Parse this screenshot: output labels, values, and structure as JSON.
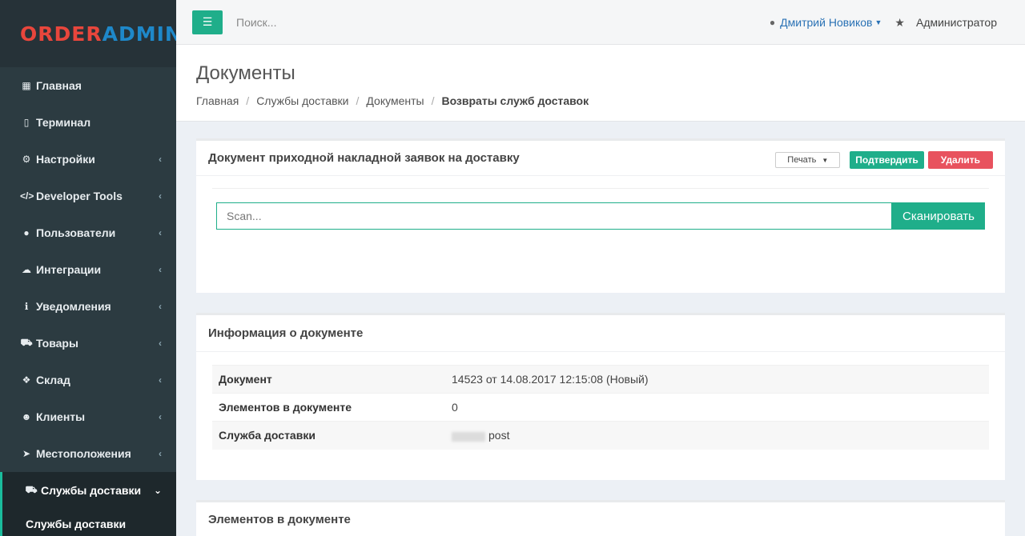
{
  "logo": {
    "part1": "ORDER",
    "part2": "ADMIN"
  },
  "sidebar": {
    "items": [
      {
        "label": "Главная",
        "icon": "grid-icon",
        "chevron": false
      },
      {
        "label": "Терминал",
        "icon": "tablet-icon",
        "chevron": false
      },
      {
        "label": "Настройки",
        "icon": "gear-icon",
        "chevron": true
      },
      {
        "label": "Developer Tools",
        "icon": "code-icon",
        "chevron": true
      },
      {
        "label": "Пользователи",
        "icon": "user-icon",
        "chevron": true
      },
      {
        "label": "Интеграции",
        "icon": "cloud-icon",
        "chevron": true
      },
      {
        "label": "Уведомления",
        "icon": "info-icon",
        "chevron": true
      },
      {
        "label": "Товары",
        "icon": "cart-icon",
        "chevron": true
      },
      {
        "label": "Склад",
        "icon": "cubes-icon",
        "chevron": true
      },
      {
        "label": "Клиенты",
        "icon": "users-icon",
        "chevron": true
      },
      {
        "label": "Местоположения",
        "icon": "location-arrow-icon",
        "chevron": true
      },
      {
        "label": "Службы доставки",
        "icon": "truck-icon",
        "chevron": true,
        "active": true
      }
    ],
    "subitem": "Службы доставки"
  },
  "topbar": {
    "search_placeholder": "Поиск...",
    "user_name": "Дмитрий Новиков",
    "role": "Администратор"
  },
  "header": {
    "title": "Документы",
    "breadcrumb": [
      "Главная",
      "Службы доставки",
      "Документы",
      "Возвраты служб доставок"
    ]
  },
  "doc_box": {
    "title": "Документ приходной накладной заявок на доставку",
    "print_label": "Печать",
    "confirm_label": "Подтвердить",
    "delete_label": "Удалить",
    "scan_placeholder": "Scan...",
    "scan_button": "Сканировать"
  },
  "info_box": {
    "title": "Информация о документе",
    "rows": [
      {
        "key": "Документ",
        "value": "14523 от 14.08.2017 12:15:08 (Новый)"
      },
      {
        "key": "Элементов в документе",
        "value": "0"
      },
      {
        "key": "Служба доставки",
        "value": "post"
      }
    ]
  },
  "elements_box": {
    "title": "Элементов в документе"
  },
  "colors": {
    "accent": "#1fae8a",
    "danger": "#e8525e",
    "sidebar": "#2c3b41",
    "link": "#2a72b5"
  }
}
